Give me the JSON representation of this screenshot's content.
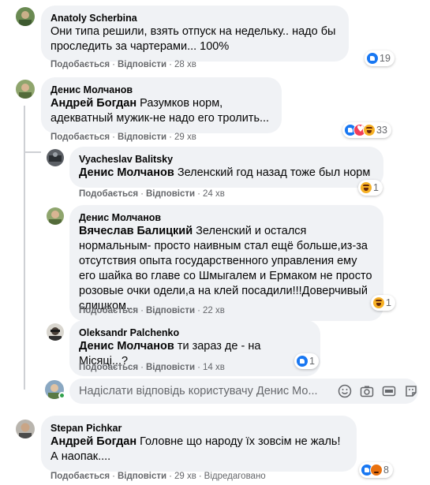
{
  "comments": [
    {
      "author": "Anatoly Scherbina",
      "mention": "",
      "text": "Они типа решили, взять отпуск на недельку.. надо бы проследить за чартерами... 100%",
      "like": "Подобається",
      "reply": "Відповісти",
      "time": "28 хв",
      "reaction_count": "19",
      "reactions": [
        "like"
      ]
    },
    {
      "author": "Денис Молчанов",
      "mention": "Андрей Богдан",
      "text": "Разумков норм, адекватный мужик-не надо его тролить...",
      "like": "Подобається",
      "reply": "Відповісти",
      "time": "29 хв",
      "reaction_count": "33",
      "reactions": [
        "like",
        "love",
        "haha"
      ]
    },
    {
      "author": "Vyacheslav Balitsky",
      "mention": "Денис Молчанов",
      "text": "Зеленский год назад тоже был норм",
      "like": "Подобається",
      "reply": "Відповісти",
      "time": "24 хв",
      "reaction_count": "1",
      "reactions": [
        "haha"
      ]
    },
    {
      "author": "Денис Молчанов",
      "mention": "Вячеслав Балицкий",
      "text": "Зеленский и остался нормальным- просто наивным стал ещё больше,из-за отсутствия опыта государственного управления ему его шайка во главе со Шмыгалем и Ермаком не просто розовые очки одели,а на клей посадили!!!Доверчивый слишком...",
      "like": "Подобається",
      "reply": "Відповісти",
      "time": "22 хв",
      "reaction_count": "1",
      "reactions": [
        "haha"
      ]
    },
    {
      "author": "Oleksandr Palchenko",
      "mention": "Денис Молчанов",
      "text": "ти зараз де - на Місяці...?",
      "like": "Подобається",
      "reply": "Відповісти",
      "time": "14 хв",
      "reaction_count": "1",
      "reactions": [
        "like"
      ]
    },
    {
      "author": "Stepan Pichkar",
      "mention": "Андрей Богдан",
      "text": "Головне що народу їх зовсім не жаль! А наопак....",
      "like": "Подобається",
      "reply": "Відповісти",
      "time": "29 хв",
      "edited": "Відредаговано",
      "reaction_count": "8",
      "reactions": [
        "like",
        "angry"
      ]
    }
  ],
  "reply_box": {
    "placeholder": "Надіслати відповідь користувачу Денис Мо..."
  },
  "icons": [
    "emoji-icon",
    "camera-icon",
    "gif-icon",
    "sticker-icon"
  ],
  "colors": {
    "bubble": "#f0f2f5",
    "meta": "#65676b",
    "like": "#1877f2",
    "love": "#f33e58",
    "haha": "#f7b125",
    "angry": "#e9710f"
  }
}
